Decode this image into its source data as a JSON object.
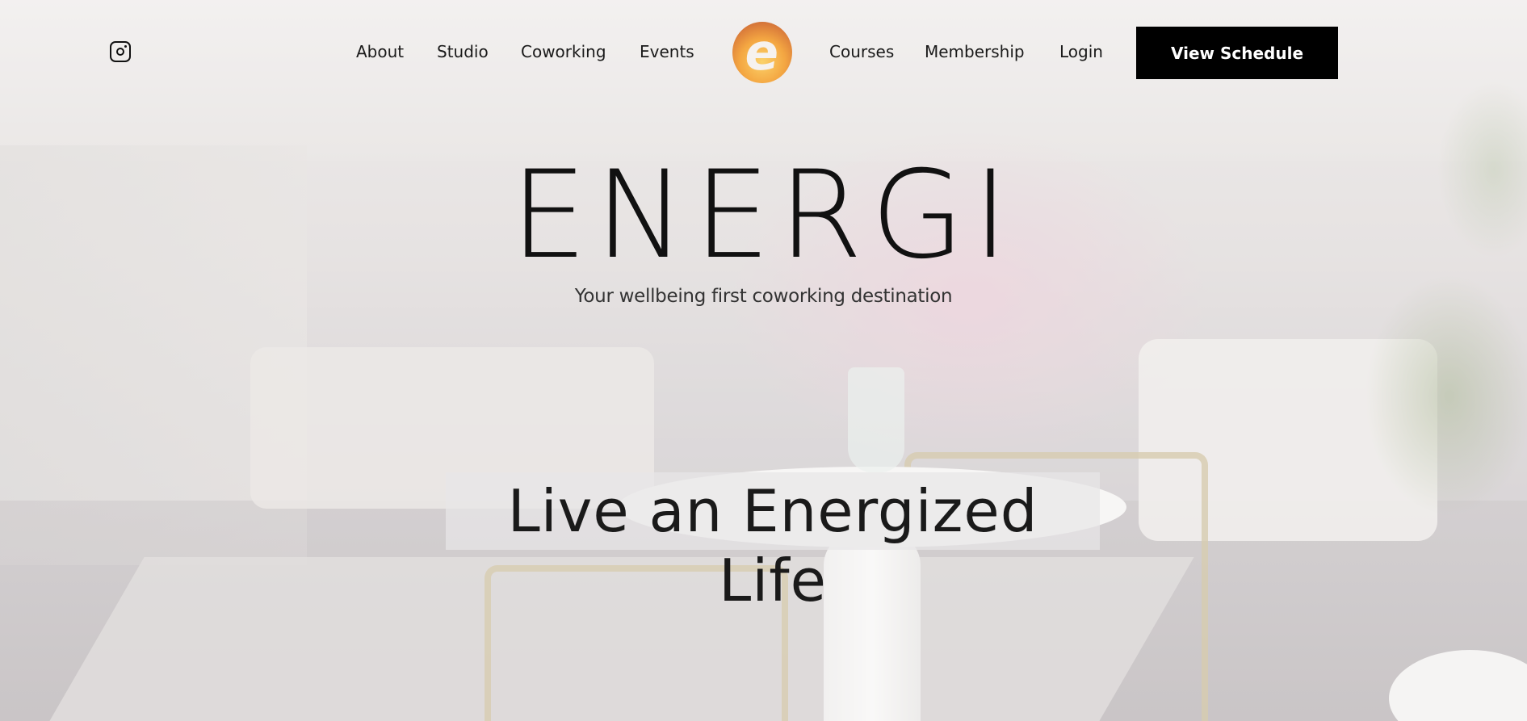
{
  "header": {
    "social": {
      "icon": "instagram-icon"
    },
    "nav_left": [
      {
        "label": "About"
      },
      {
        "label": "Studio"
      },
      {
        "label": "Coworking"
      },
      {
        "label": "Events"
      }
    ],
    "logo": {
      "icon": "energi-e-logo"
    },
    "nav_right": [
      {
        "label": "Courses"
      },
      {
        "label": "Membership"
      },
      {
        "label": "Login"
      }
    ],
    "cta_label": "View Schedule"
  },
  "hero": {
    "brand": "ENERGI",
    "tagline": "Your wellbeing first coworking destination",
    "slogan": "Live an Energized Life"
  },
  "colors": {
    "text": "#111111",
    "cta_background": "#000000",
    "cta_text": "#ffffff",
    "logo_gradient": [
      "#fbd26a",
      "#f4a742",
      "#d97a3a"
    ]
  }
}
